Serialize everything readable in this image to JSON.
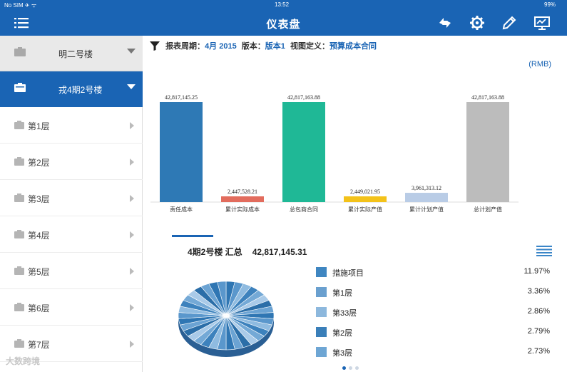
{
  "status_bar": {
    "carrier": "No SIM ✈ ᯤ",
    "time": "13:52",
    "battery": "99%"
  },
  "nav": {
    "title": "仪表盘",
    "icons": [
      "menu-icon",
      "refresh-icon",
      "gear-icon",
      "pencil-icon",
      "monitor-icon"
    ]
  },
  "sidebar": {
    "projects": [
      {
        "label": "明二号楼"
      },
      {
        "label": "戎4期2号楼"
      }
    ],
    "floors": [
      "第1层",
      "第2层",
      "第3层",
      "第4层",
      "第5层",
      "第6层",
      "第7层"
    ]
  },
  "filter": {
    "period_label": "报表周期：",
    "period_value": "4月 2015",
    "version_label": "版本：",
    "version_value": "版本1",
    "view_label": "视图定义：",
    "view_value": "预算成本合同"
  },
  "currency": "(RMB)",
  "chart_data": {
    "type": "bar",
    "categories": [
      "责任成本",
      "累计实际成本",
      "总包商合同",
      "累计实际产值",
      "累计计划产值",
      "总计划产值"
    ],
    "values": [
      42817145.25,
      2447528.21,
      42817163.88,
      2449021.95,
      3961313.12,
      42817163.88
    ],
    "value_labels": [
      "42,817,145.25",
      "2,447,528.21",
      "42,817,163.88",
      "2,449,021.95",
      "3,961,313.12",
      "42,817,163.88"
    ],
    "colors": [
      "#2e79b5",
      "#e26c5d",
      "#1fb896",
      "#f3c21a",
      "#b9cce6",
      "#bcbcbc"
    ],
    "ylim": [
      0,
      42817163.88
    ]
  },
  "summary": {
    "title": "4期2号楼 汇总",
    "total": "42,817,145.31"
  },
  "legend": [
    {
      "name": "措施项目",
      "percent": "11.97%",
      "color": "#3f86c1"
    },
    {
      "name": "第1层",
      "percent": "3.36%",
      "color": "#6aa0cf"
    },
    {
      "name": "第33层",
      "percent": "2.86%",
      "color": "#8db8dd"
    },
    {
      "name": "第2层",
      "percent": "2.79%",
      "color": "#3a7fb9"
    },
    {
      "name": "第3层",
      "percent": "2.73%",
      "color": "#6ea6d4"
    }
  ],
  "pie": {
    "slices": 34
  },
  "watermark": "大数跨境"
}
